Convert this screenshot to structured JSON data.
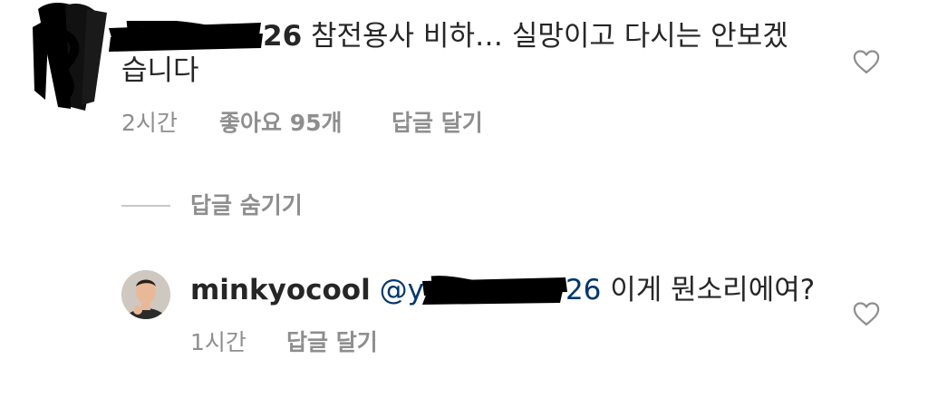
{
  "comment1": {
    "username_visible_suffix": "26",
    "text_line1": "참전용사 비하… 실망이고 다시는 안보겠",
    "text_line2": "습니다",
    "time": "2시간",
    "likes": "좋아요 95개",
    "reply_action": "답글 달기"
  },
  "replies_toggle": {
    "label": "답글 숨기기"
  },
  "reply1": {
    "username": "minkyocool",
    "mention_prefix": "@y",
    "mention_suffix": "26",
    "text": "이게 뭔소리에여?",
    "time": "1시간",
    "reply_action": "답글 달기"
  },
  "icons": {
    "like": "heart-outline-icon"
  },
  "colors": {
    "text": "#262626",
    "secondary": "#8e8e8e",
    "mention": "#00376b",
    "divider": "#c7c7c7",
    "redaction": "#000000"
  }
}
